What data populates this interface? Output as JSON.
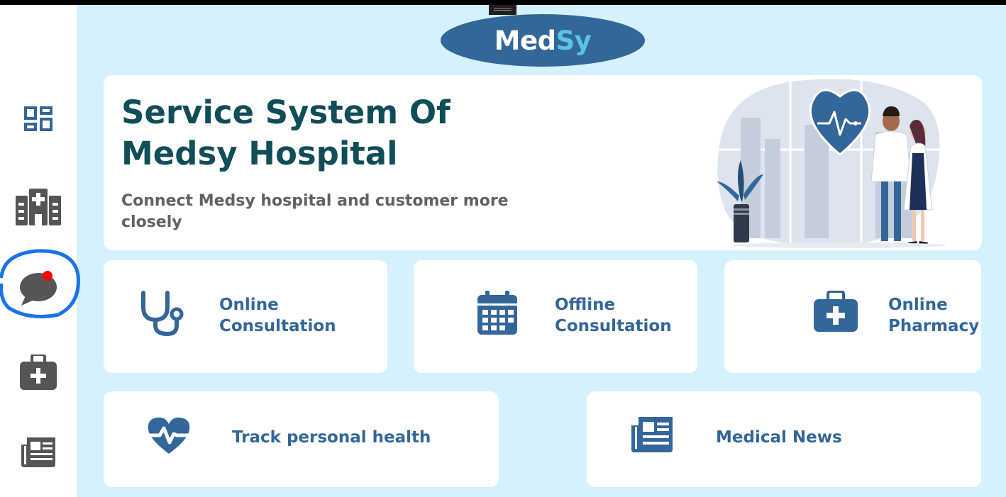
{
  "app": {
    "logo": {
      "part1": "Med",
      "part2": "Sy"
    }
  },
  "sidebar": {
    "items": [
      {
        "name": "dashboard",
        "icon": "dashboard-grid-icon"
      },
      {
        "name": "hospital",
        "icon": "hospital-icon"
      },
      {
        "name": "chat",
        "icon": "chat-bubble-icon",
        "notification": true
      },
      {
        "name": "pharmacy",
        "icon": "medical-kit-icon"
      },
      {
        "name": "news",
        "icon": "newspaper-icon"
      }
    ]
  },
  "hero": {
    "title": "Service System Of Medsy Hospital",
    "subtitle": "Connect Medsy hospital and customer more closely"
  },
  "services": {
    "online_consultation": {
      "label_line1": "Online",
      "label_line2": "Consultation",
      "icon": "stethoscope-icon"
    },
    "offline_consultation": {
      "label_line1": "Offline",
      "label_line2": "Consultation",
      "icon": "calendar-icon"
    },
    "online_pharmacy": {
      "label_line1": "Online",
      "label_line2": "Pharmacy",
      "icon": "medical-kit-icon"
    },
    "track_health": {
      "label": "Track personal health",
      "icon": "heartbeat-icon"
    },
    "medical_news": {
      "label": "Medical News",
      "icon": "newspaper-icon"
    }
  },
  "colors": {
    "brand": "#336699",
    "background": "#d4f1fc",
    "heading": "#0f4d58",
    "sidebar_icon": "#555555",
    "notification": "#ff0000",
    "annotation": "#1a73e8"
  }
}
